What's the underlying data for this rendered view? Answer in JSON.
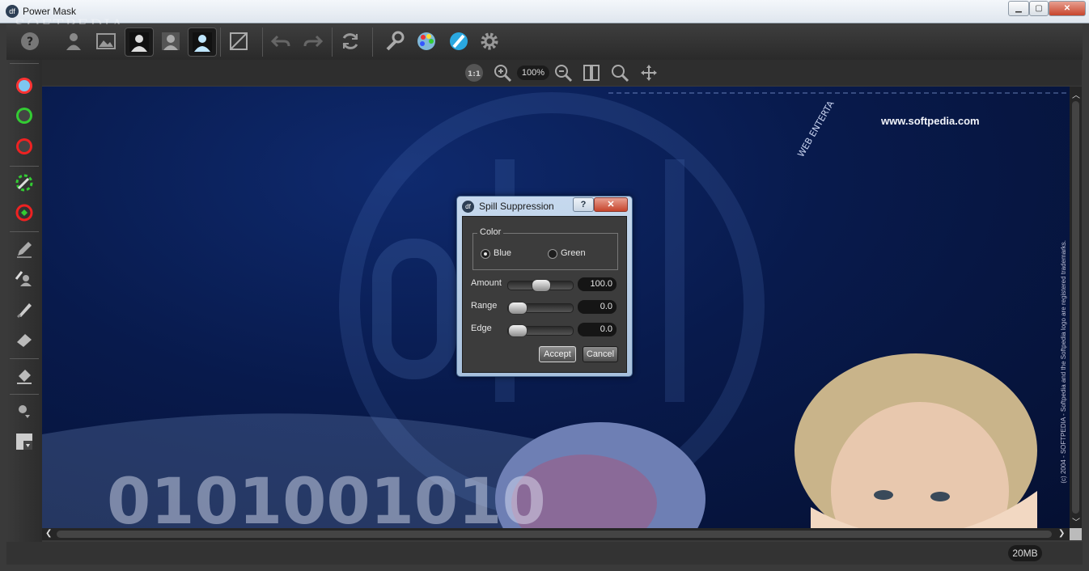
{
  "window": {
    "title": "Power Mask",
    "watermark": "SOFTPEDIA",
    "watermark_url": "www.softpedia.com"
  },
  "toolbar": {
    "icons": [
      "help-icon",
      "person-icon",
      "image-icon",
      "silhouette-icon",
      "portrait-icon",
      "masked-portrait-icon",
      "compare-icon",
      "undo-icon",
      "redo-icon",
      "refresh-icon",
      "wrench-icon",
      "palette-icon",
      "brush-color-icon",
      "settings-icon"
    ]
  },
  "tools": [
    "blue-sample-icon",
    "green-keep-icon",
    "red-drop-icon",
    "magic-wand-icon",
    "auto-mask-icon",
    "pencil-icon",
    "keep-brush-icon",
    "drop-brush-icon",
    "eraser-icon",
    "fill-icon",
    "pointer-icon",
    "background-icon"
  ],
  "zoom": {
    "actual_size_label": "1:1",
    "level": "100%"
  },
  "canvas": {
    "site_url": "www.softpedia.com",
    "copyright_text": "(c) 2004 - SOFTPEDIA - Softpedia and the Softpedia logo are registered trademarks.",
    "web_text": "WEB ENTERTA",
    "binary_text": "0101001010"
  },
  "status": {
    "memory": "20MB"
  },
  "dialog": {
    "title": "Spill Suppression",
    "help_label": "?",
    "close_label": "✕",
    "color_group_label": "Color",
    "options": [
      {
        "label": "Blue",
        "checked": true
      },
      {
        "label": "Green",
        "checked": false
      }
    ],
    "sliders": [
      {
        "label": "Amount",
        "value": "100.0",
        "level": 0.5
      },
      {
        "label": "Range",
        "value": "0.0",
        "level": 0.0
      },
      {
        "label": "Edge",
        "value": "0.0",
        "level": 0.0
      }
    ],
    "accept_label": "Accept",
    "cancel_label": "Cancel"
  }
}
